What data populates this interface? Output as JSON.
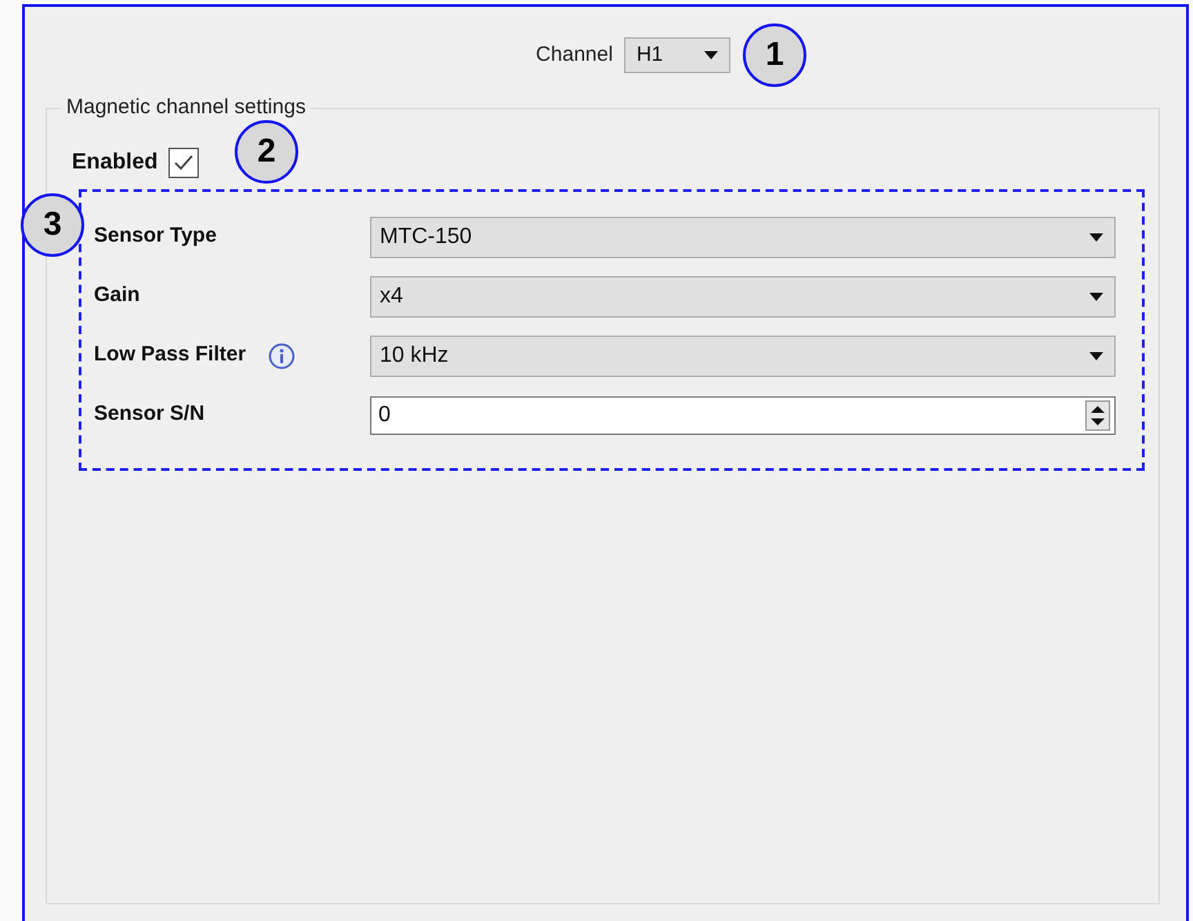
{
  "channel": {
    "label": "Channel",
    "value": "H1"
  },
  "callouts": [
    "1",
    "2",
    "3"
  ],
  "group": {
    "title": "Magnetic channel settings",
    "enabled": {
      "label": "Enabled",
      "checked": true
    },
    "fields": [
      {
        "kind": "combo",
        "label": "Sensor Type",
        "value": "MTC-150",
        "info": false
      },
      {
        "kind": "combo",
        "label": "Gain",
        "value": "x4",
        "info": false
      },
      {
        "kind": "combo",
        "label": "Low Pass Filter",
        "value": "10 kHz",
        "info": true
      },
      {
        "kind": "spin",
        "label": "Sensor S/N",
        "value": "0",
        "info": false
      }
    ]
  }
}
